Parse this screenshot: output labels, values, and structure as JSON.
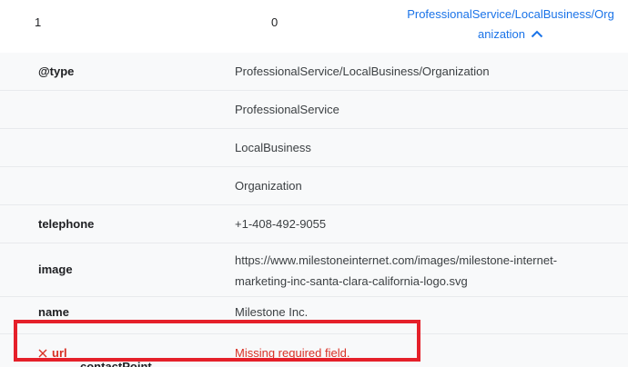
{
  "summary": {
    "col1": "1",
    "col2": "0",
    "type_line1": "ProfessionalService/LocalBusiness/Org",
    "type_line2": "anization",
    "chevron_icon": "chevron-up-icon"
  },
  "rows": [
    {
      "key": "@type",
      "value": "ProfessionalService/LocalBusiness/Organization"
    },
    {
      "key": "",
      "value": "ProfessionalService"
    },
    {
      "key": "",
      "value": "LocalBusiness"
    },
    {
      "key": "",
      "value": "Organization"
    },
    {
      "key": "telephone",
      "value": "+1-408-492-9055"
    },
    {
      "key": "image",
      "value_line1": "https://www.milestoneinternet.com/images/milestone-internet-",
      "value_line2": "marketing-inc-santa-clara-california-logo.svg"
    },
    {
      "key": "name",
      "value": "Milestone Inc."
    },
    {
      "key": "url",
      "value": "Missing required field.",
      "status": "error",
      "icon": "close-icon"
    }
  ],
  "partial_key": "contactPoint",
  "colors": {
    "link": "#1a73e8",
    "error": "#d93025",
    "highlight": "#e5202a",
    "row_bg": "#f8f9fa"
  }
}
